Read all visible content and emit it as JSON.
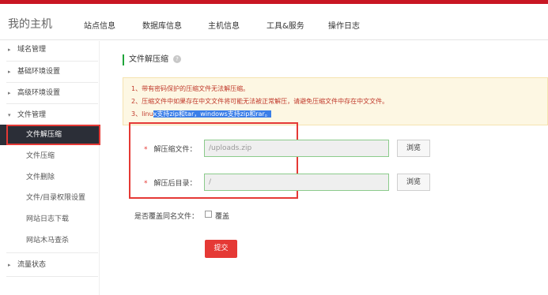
{
  "header": {
    "site_title": "我的主机",
    "tabs": [
      {
        "label": "站点信息"
      },
      {
        "label": "数据库信息"
      },
      {
        "label": "主机信息"
      },
      {
        "label": "工具&服务"
      },
      {
        "label": "操作日志"
      }
    ]
  },
  "sidebar": {
    "items": [
      {
        "label": "域名管理"
      },
      {
        "label": "基础环境设置"
      },
      {
        "label": "高级环境设置"
      },
      {
        "label": "文件管理"
      },
      {
        "label": "文件解压缩"
      },
      {
        "label": "文件压缩"
      },
      {
        "label": "文件删除"
      },
      {
        "label": "文件/目录权限设置"
      },
      {
        "label": "网站日志下载"
      },
      {
        "label": "网站木马查杀"
      },
      {
        "label": "流量状态"
      }
    ],
    "caret_collapsed": "▸",
    "caret_expanded": "▾"
  },
  "main": {
    "section_title": "文件解压缩",
    "help_glyph": "?",
    "notice": {
      "line1": "1、带有密码保护的压缩文件无法解压缩。",
      "line2": "2、压缩文件中如果存在中文文件将可能无法被正常解压，请避免压缩文件中存在中文文件。",
      "line3_prefix": "3、linu",
      "line3_highlight": "x支持zip和tar，windows支持zip和rar。"
    },
    "form": {
      "required_mark": "*",
      "archive_label": "解压缩文件：",
      "archive_value": "/uploads.zip",
      "target_label": "解压后目录：",
      "target_value": "/",
      "browse_label": "浏览",
      "overwrite_label": "是否覆盖同名文件：",
      "overwrite_option": "覆盖",
      "submit_label": "提交"
    }
  },
  "colors": {
    "accent_red": "#e53935",
    "active_sidebar_bg": "#2b2e37",
    "notice_bg": "#fdf7e3",
    "input_border_green": "#8ccb8c",
    "highlight_blue": "#3a7ee8"
  }
}
